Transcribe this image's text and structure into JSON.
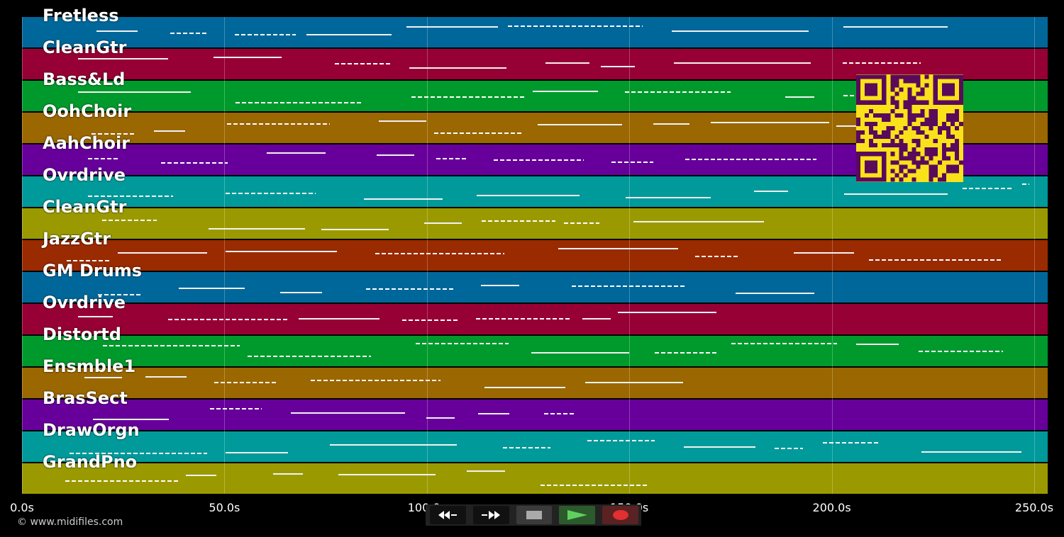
{
  "tracks": [
    {
      "label": "Fretless",
      "color": "#00679a"
    },
    {
      "label": "CleanGtr",
      "color": "#970034"
    },
    {
      "label": "Bass&Ld",
      "color": "#009a2c"
    },
    {
      "label": "OohChoir",
      "color": "#9a6700"
    },
    {
      "label": "AahChoir",
      "color": "#67009a"
    },
    {
      "label": "Ovrdrive",
      "color": "#009a9a"
    },
    {
      "label": "CleanGtr",
      "color": "#9a9a00"
    },
    {
      "label": "JazzGtr",
      "color": "#9a2a00"
    },
    {
      "label": "GM Drums",
      "color": "#00679a"
    },
    {
      "label": "Ovrdrive",
      "color": "#970034"
    },
    {
      "label": "Distortd",
      "color": "#009a2c"
    },
    {
      "label": "Ensmble1",
      "color": "#9a6700"
    },
    {
      "label": "BrasSect",
      "color": "#67009a"
    },
    {
      "label": "DrawOrgn",
      "color": "#009a9a"
    },
    {
      "label": "GrandPno",
      "color": "#9a9a00"
    }
  ],
  "timeline": {
    "ticks": [
      "0.0s",
      "50.0s",
      "100.0s",
      "150.0s",
      "200.0s",
      "250.0s"
    ]
  },
  "transport": {
    "rewind_icon": "rewind-icon",
    "forward_icon": "fast-forward-icon",
    "stop_icon": "stop-icon",
    "play_icon": "play-icon",
    "record_icon": "record-icon"
  },
  "copyright": "© www.midifiles.com"
}
